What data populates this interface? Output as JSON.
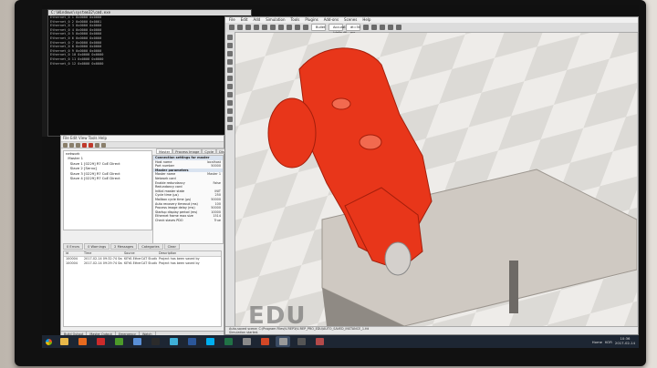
{
  "terminal": {
    "title": "C:\\Windows\\system32\\cmd.exe",
    "lines": [
      "Ethernet_0  1  0x0000  0x0000",
      "Ethernet_0  2  0x0000  0x0001",
      "Ethernet_0  3  0x0000  0x0000",
      "Ethernet_0  4  0x0000  0x0000",
      "Ethernet_0  5  0x0000  0x0000",
      "Ethernet_0  6  0x0000  0x0000",
      "Ethernet_0  7  0x0000  0x0000",
      "Ethernet_0  8  0x0000  0x0000",
      "Ethernet_0  9  0x0000  0x0000",
      "Ethernet_0 10  0x0000  0x0000",
      "Ethernet_0 11  0x0000  0x0000",
      "Ethernet_0 12  0x0000  0x0000"
    ]
  },
  "engineering": {
    "menu": "File  Edit  View  Tools  Help",
    "tabs": [
      "Master",
      "Process Image",
      "Cycle",
      "Distributed Clocks"
    ],
    "tree": [
      "network",
      "  Master 1",
      "    Slave 1 [0229] R? CoE Direct",
      "    Slave 2 [Servo]",
      "    Slave 3 [0229] R? CoE Direct",
      "    Slave 4 [0229] R? CoE Direct"
    ],
    "properties": [
      {
        "k": "Connection settings for master",
        "v": "",
        "hdr": true
      },
      {
        "k": "Host name",
        "v": "localhost"
      },
      {
        "k": "Port number",
        "v": "50000"
      },
      {
        "k": "Master parameters",
        "v": "",
        "hdr": true
      },
      {
        "k": "Master name",
        "v": "Master 1"
      },
      {
        "k": "Network card",
        "v": ""
      },
      {
        "k": "Enable redundancy",
        "v": "False"
      },
      {
        "k": "Redundancy card",
        "v": ""
      },
      {
        "k": "Initial master state",
        "v": "INIT"
      },
      {
        "k": "Cycle time (µs)",
        "v": "250"
      },
      {
        "k": "Mailbox cycle time (µs)",
        "v": "50000"
      },
      {
        "k": "Auto recovery timeout (ms)",
        "v": "100"
      },
      {
        "k": "Process image delay (ms)",
        "v": "50000"
      },
      {
        "k": "Startup display period (ms)",
        "v": "10000"
      },
      {
        "k": "Ethernet frame max size",
        "v": "1514"
      },
      {
        "k": "Check slaves PDO",
        "v": "True"
      }
    ],
    "message_tabs": [
      "0 Errors",
      "0 Warnings",
      "2 Messages",
      "Categories",
      "Clear"
    ],
    "message_columns": [
      "Id",
      "Time",
      "Source",
      "Description"
    ],
    "messages": [
      {
        "id": "100004",
        "time": "2017-02-14 09:32:74 Sea",
        "source": "KEYA EtherCAT Studio Premium",
        "desc": "Project has been saved by"
      },
      {
        "id": "100004",
        "time": "2017-02-14 09:29:74 Sea",
        "source": "KEYA EtherCAT Studio Premium",
        "desc": "Project has been saved by"
      }
    ],
    "bottom_tabs": [
      "Build Output",
      "Master Output",
      "Emergency",
      "Watch"
    ]
  },
  "simulation": {
    "menu": [
      "File",
      "Edit",
      "Add",
      "Simulation",
      "Tools",
      "Plugins",
      "Add-ons",
      "Scenes",
      "Help"
    ],
    "dropdowns": [
      "Bullet",
      "Accurate (default)",
      "dt=50 ms"
    ],
    "watermark": "EDU",
    "status_lines": [
      "Auto-saved scene: C:/Program Files/V-REP3/V-REP_PRO_EDU/AUTO_SAVED_INSTANCE_1.ttt",
      "Simulation started."
    ],
    "robot_color": "#e8361a"
  },
  "taskbar": {
    "apps": [
      {
        "name": "file-explorer",
        "color": "#e8b84a"
      },
      {
        "name": "firefox",
        "color": "#e66a1f"
      },
      {
        "name": "media-player",
        "color": "#cc2b2b"
      },
      {
        "name": "chrome",
        "color": "#4c9a2a"
      },
      {
        "name": "network",
        "color": "#5a8fd6"
      },
      {
        "name": "terminal",
        "color": "#2b2b2b"
      },
      {
        "name": "ethercat",
        "color": "#3fb0d8"
      },
      {
        "name": "word",
        "color": "#2b579a"
      },
      {
        "name": "skype",
        "color": "#00aff0"
      },
      {
        "name": "excel",
        "color": "#217346"
      },
      {
        "name": "settings",
        "color": "#8a8a8a"
      },
      {
        "name": "powerpoint",
        "color": "#d24726"
      },
      {
        "name": "vrep",
        "color": "#9a9a9a"
      },
      {
        "name": "chip",
        "color": "#555555"
      },
      {
        "name": "browser",
        "color": "#b34a4a"
      }
    ],
    "tray_text": "Home",
    "lang": "KOR",
    "time": "10:36",
    "date": "2017-02-14"
  }
}
